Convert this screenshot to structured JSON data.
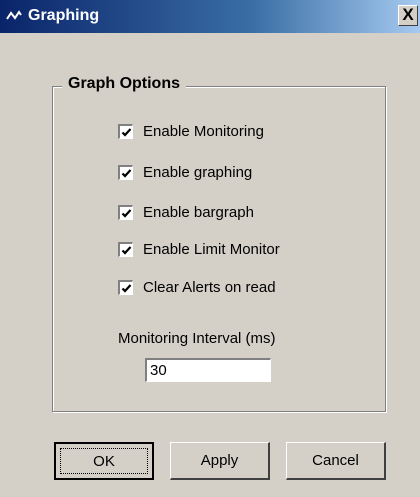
{
  "window": {
    "title": "Graphing",
    "close_label": "X"
  },
  "group": {
    "title": "Graph Options",
    "checkboxes": [
      {
        "label": "Enable Monitoring",
        "checked": true
      },
      {
        "label": "Enable graphing",
        "checked": true
      },
      {
        "label": "Enable bargraph",
        "checked": true
      },
      {
        "label": "Enable Limit Monitor",
        "checked": true
      },
      {
        "label": "Clear Alerts on read",
        "checked": true
      }
    ],
    "interval_label": "Monitoring Interval (ms)",
    "interval_value": "30"
  },
  "buttons": {
    "ok": "OK",
    "apply": "Apply",
    "cancel": "Cancel"
  },
  "colors": {
    "titlebar_start": "#0a246a",
    "titlebar_end": "#a6caf0",
    "face": "#d4d0c8"
  },
  "icons": {
    "app": "graph-icon",
    "check": "check-icon"
  }
}
